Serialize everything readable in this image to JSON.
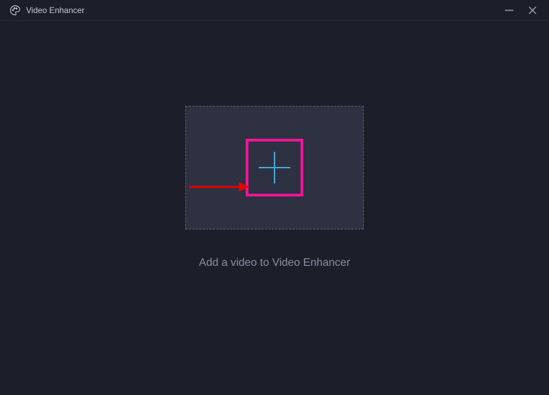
{
  "titlebar": {
    "app_title": "Video Enhancer"
  },
  "dropzone": {
    "caption": "Add a video to Video Enhancer"
  },
  "colors": {
    "background": "#1c1e2a",
    "dropzone_bg": "#2e3142",
    "dropzone_border": "#5b5f72",
    "plus_icon": "#49a8d4",
    "highlight": "#ef1597",
    "arrow": "#e40000",
    "text_primary": "#c8cad4",
    "text_secondary": "#8b8fa1"
  },
  "icons": {
    "app": "palette-icon",
    "minimize": "minus-icon",
    "close": "x-icon",
    "add": "plus-icon"
  }
}
